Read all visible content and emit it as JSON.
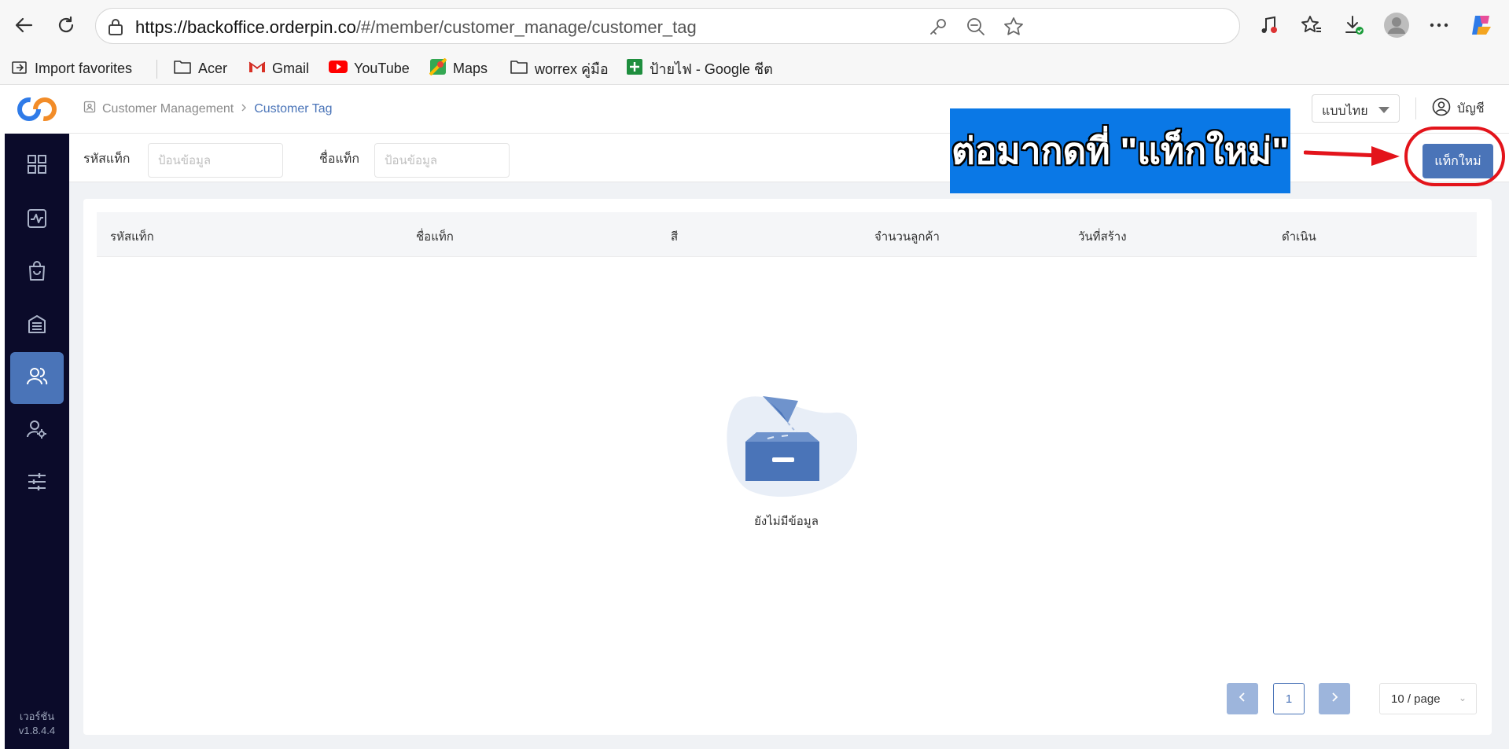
{
  "browser": {
    "url_host": "https://backoffice.orderpin.co",
    "url_path": "/#/member/customer_manage/customer_tag",
    "bookmarks": [
      {
        "label": "Import favorites",
        "icon": "import-icon"
      },
      {
        "label": "Acer",
        "icon": "folder-icon"
      },
      {
        "label": "Gmail",
        "icon": "gmail-icon"
      },
      {
        "label": "YouTube",
        "icon": "youtube-icon"
      },
      {
        "label": "Maps",
        "icon": "maps-icon"
      },
      {
        "label": "worrex คู่มือ",
        "icon": "folder-icon"
      },
      {
        "label": "ป้ายไฟ - Google ชีต",
        "icon": "sheets-icon"
      }
    ]
  },
  "sidebar": {
    "items": [
      {
        "icon": "dashboard-icon"
      },
      {
        "icon": "activity-icon"
      },
      {
        "icon": "shopping-bag-icon"
      },
      {
        "icon": "building-icon"
      },
      {
        "icon": "users-icon",
        "active": true
      },
      {
        "icon": "user-settings-icon"
      },
      {
        "icon": "sliders-icon"
      }
    ],
    "version_label": "เวอร์ชัน",
    "version_value": "v1.8.4.4"
  },
  "header": {
    "breadcrumb": [
      "Customer Management",
      "Customer Tag"
    ],
    "language": "แบบไทย",
    "account_label": "บัญชี"
  },
  "filters": {
    "tag_code_label": "รหัสแท็ก",
    "tag_code_placeholder": "ป้อนข้อมูล",
    "tag_name_label": "ชื่อแท็ก",
    "tag_name_placeholder": "ป้อนข้อมูล",
    "new_tag_button": "แท็กใหม่"
  },
  "annotation": {
    "text": "ต่อมากดที่ \"แท็กใหม่\"",
    "highlight_color": "#e3141b",
    "background_color": "#0a78e6"
  },
  "table": {
    "columns": [
      "รหัสแท็ก",
      "ชื่อแท็ก",
      "สี",
      "จำนวนลูกค้า",
      "วันที่สร้าง",
      "ดำเนิน"
    ],
    "rows": [],
    "empty_text": "ยังไม่มีข้อมูล"
  },
  "pagination": {
    "current_page": "1",
    "page_size": "10 / page"
  },
  "colors": {
    "accent": "#4a74b8",
    "sidebar_bg": "#0b0b2a"
  }
}
